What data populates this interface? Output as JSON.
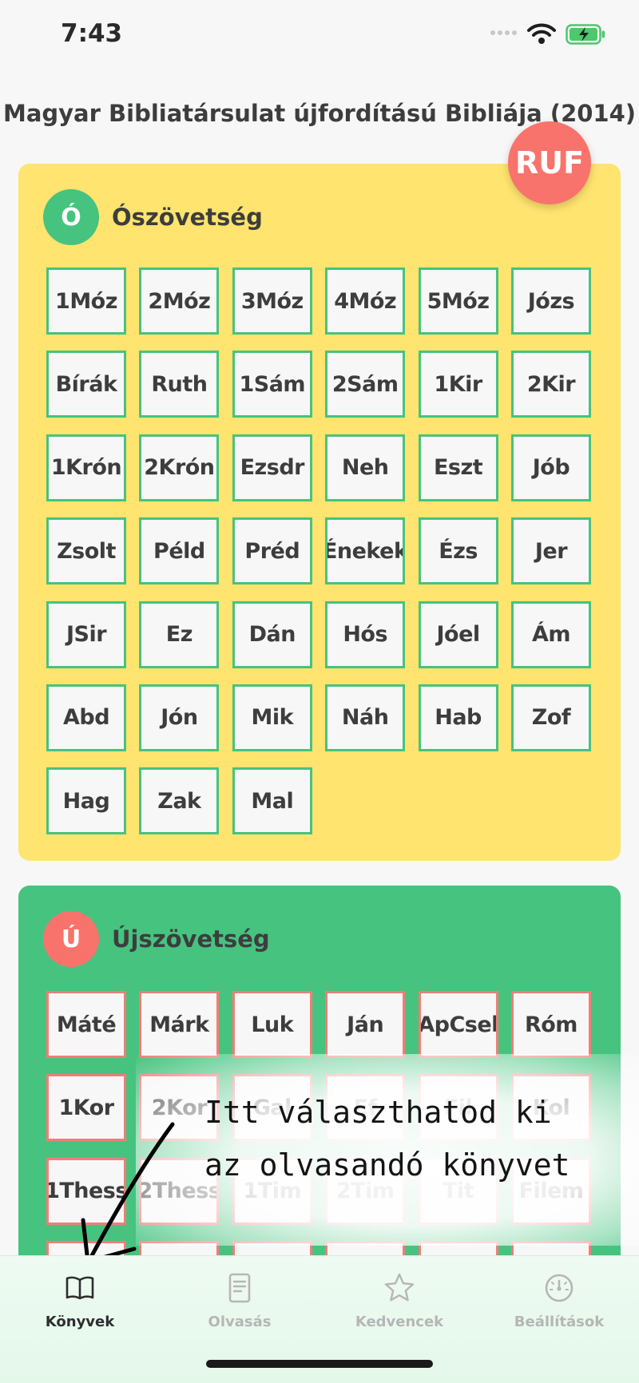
{
  "status_bar": {
    "time": "7:43"
  },
  "title": "Magyar Bibliatársulat újfordítású Bibliája (2014)",
  "translation_badge": "RUF",
  "old_testament": {
    "badge": "Ó",
    "title": "Ószövetség",
    "books": [
      "1Móz",
      "2Móz",
      "3Móz",
      "4Móz",
      "5Móz",
      "Józs",
      "Bírák",
      "Ruth",
      "1Sám",
      "2Sám",
      "1Kir",
      "2Kir",
      "1Krón",
      "2Krón",
      "Ezsdr",
      "Neh",
      "Eszt",
      "Jób",
      "Zsolt",
      "Péld",
      "Préd",
      "Énekek",
      "Ézs",
      "Jer",
      "JSir",
      "Ez",
      "Dán",
      "Hós",
      "Jóel",
      "Ám",
      "Abd",
      "Jón",
      "Mik",
      "Náh",
      "Hab",
      "Zof",
      "Hag",
      "Zak",
      "Mal"
    ]
  },
  "new_testament": {
    "badge": "Ú",
    "title": "Újszövetség",
    "books": [
      "Máté",
      "Márk",
      "Luk",
      "Ján",
      "ApCsel",
      "Róm",
      "1Kor",
      "2Kor",
      "Gal",
      "Ef",
      "Fil",
      "Kol",
      "1Thess",
      "2Thess",
      "1Tim",
      "2Tim",
      "Tit",
      "Filem",
      "",
      "",
      "",
      "",
      "",
      ""
    ]
  },
  "hint": {
    "line1": "Itt választhatod ki",
    "line2": "az olvasandó könyvet"
  },
  "tabs": [
    {
      "label": "Könyvek",
      "icon": "book-open-icon",
      "active": true
    },
    {
      "label": "Olvasás",
      "icon": "document-icon",
      "active": false
    },
    {
      "label": "Kedvencek",
      "icon": "star-icon",
      "active": false
    },
    {
      "label": "Beállítások",
      "icon": "gauge-icon",
      "active": false
    }
  ],
  "colors": {
    "old_testament_bg": "#ffe46f",
    "new_testament_bg": "#46c37f",
    "accent_red": "#f8736b",
    "accent_green": "#46c37f"
  }
}
